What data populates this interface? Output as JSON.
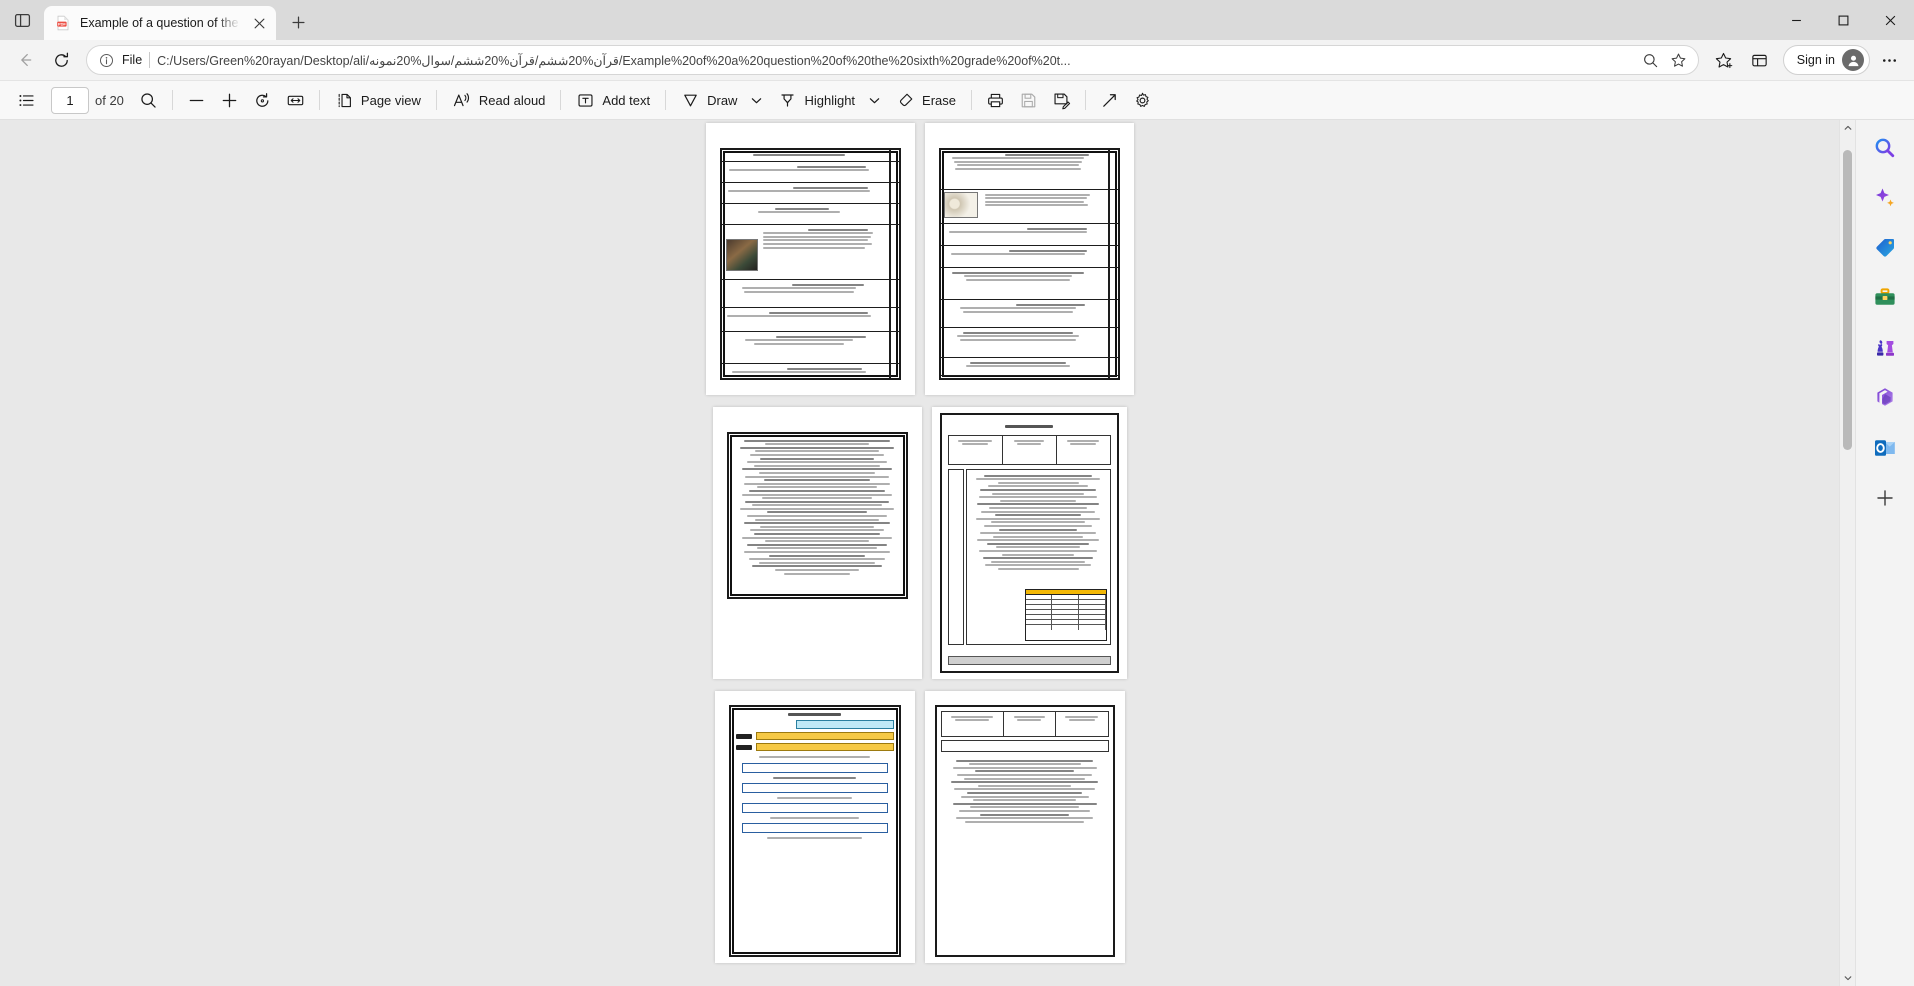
{
  "window": {
    "tab": {
      "title": "Example of a question of the sixth",
      "favicon": "pdf-icon",
      "close_label": "×"
    },
    "new_tab_label": "+",
    "controls": {
      "minimize": "—",
      "maximize": "□",
      "close": "✕"
    },
    "tab_actions_icon": "tab-actions-icon"
  },
  "navbar": {
    "back_icon": "back-arrow-icon",
    "refresh_icon": "refresh-icon",
    "info_icon": "info-circle-icon",
    "scheme_label": "File",
    "url": "C:/Users/Green%20rayan/Desktop/ali/قرآن%20ششم/قرآن%20ششم/سوال%20نمونه/Example%20of%20a%20question%20of%20the%20sixth%20grade%20of%20t...",
    "zoom_icon": "zoom-glass-icon",
    "favorite_icon": "star-icon",
    "collections_icon": "collections-icon",
    "favorites_bar_icon": "favorites-icon",
    "signin_label": "Sign in",
    "avatar_icon": "person-avatar-icon",
    "settings_icon": "ellipsis-icon"
  },
  "pdf_toolbar": {
    "toc_icon": "table-of-contents-icon",
    "page_number": "1",
    "page_total": "of 20",
    "search_icon": "search-icon",
    "zoom_out_label": "−",
    "zoom_in_label": "+",
    "rotate_icon": "rotate-icon",
    "fit_icon": "fit-to-width-icon",
    "page_view_label": "Page view",
    "page_view_icon": "page-view-icon",
    "read_aloud_label": "Read aloud",
    "read_aloud_icon": "read-aloud-icon",
    "add_text_label": "Add text",
    "add_text_icon": "add-text-icon",
    "draw_label": "Draw",
    "draw_icon": "draw-pen-icon",
    "draw_chevron": "chevron-down-icon",
    "highlight_label": "Highlight",
    "highlight_icon": "highlighter-icon",
    "highlight_chevron": "chevron-down-icon",
    "erase_label": "Erase",
    "erase_icon": "eraser-icon",
    "print_icon": "print-icon",
    "save_icon": "save-icon",
    "save_as_icon": "save-as-icon",
    "expand_icon": "expand-diagonal-icon",
    "settings_icon": "gear-icon"
  },
  "sidebar": {
    "items": [
      {
        "name": "search",
        "icon": "search-magnifier-icon",
        "glyph": "🔍"
      },
      {
        "name": "copilot",
        "icon": "copilot-sparkle-icon",
        "glyph": "✦"
      },
      {
        "name": "shopping",
        "icon": "shopping-tag-icon",
        "glyph": "🏷"
      },
      {
        "name": "tools",
        "icon": "toolbox-icon",
        "glyph": "🧰"
      },
      {
        "name": "games",
        "icon": "games-chess-icon",
        "glyph": "♟"
      },
      {
        "name": "microsoft365",
        "icon": "microsoft-365-icon",
        "glyph": "◐"
      },
      {
        "name": "outlook",
        "icon": "outlook-icon",
        "glyph": "▣"
      },
      {
        "name": "add",
        "icon": "plus-icon",
        "glyph": "＋"
      }
    ]
  },
  "document": {
    "pages": [
      {
        "n": 1,
        "label": "page-1"
      },
      {
        "n": 2,
        "label": "page-2"
      },
      {
        "n": 3,
        "label": "page-3"
      },
      {
        "n": 4,
        "label": "page-4"
      },
      {
        "n": 5,
        "label": "page-5"
      },
      {
        "n": 6,
        "label": "page-6"
      }
    ]
  },
  "colors": {
    "tab_strip": "#dadada",
    "toolbar": "#f8f8f8",
    "viewer_bg": "#e8e8e8",
    "accent_blue": "#0f6cbd",
    "table_header_gold": "#f2b705",
    "highlight_cyan": "#bfe9f7"
  }
}
